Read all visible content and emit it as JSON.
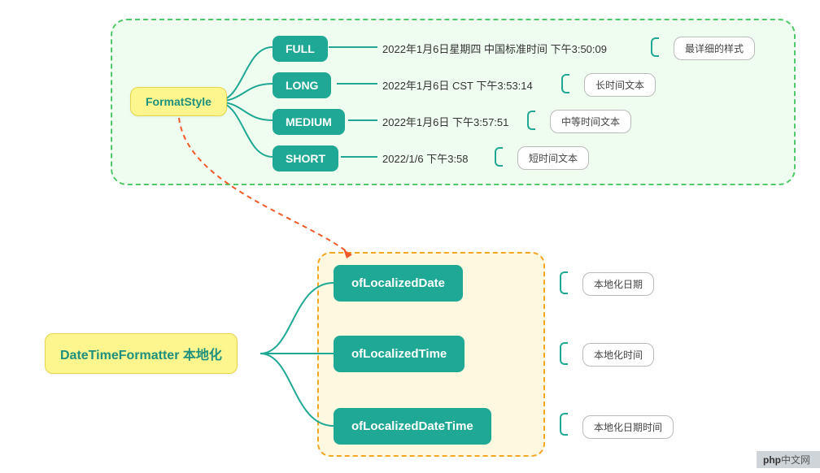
{
  "top": {
    "root": "FormatStyle",
    "items": [
      {
        "label": "FULL",
        "example": "2022年1月6日星期四 中国标准时间 下午3:50:09",
        "note": "最详细的样式"
      },
      {
        "label": "LONG",
        "example": "2022年1月6日 CST 下午3:53:14",
        "note": "长时间文本"
      },
      {
        "label": "MEDIUM",
        "example": "2022年1月6日 下午3:57:51",
        "note": "中等时间文本"
      },
      {
        "label": "SHORT",
        "example": "2022/1/6 下午3:58",
        "note": "短时间文本"
      }
    ]
  },
  "bottom": {
    "root": "DateTimeFormatter 本地化",
    "items": [
      {
        "label": "ofLocalizedDate",
        "note": "本地化日期"
      },
      {
        "label": "ofLocalizedTime",
        "note": "本地化时间"
      },
      {
        "label": "ofLocalizedDateTime",
        "note": "本地化日期时间"
      }
    ]
  },
  "watermark": {
    "strong": "php",
    "rest": "中文网"
  },
  "colors": {
    "teal": "#1fa994",
    "yellow": "#fdf68e",
    "green": "#4fc96a",
    "orange": "#f5a623"
  },
  "chart_data": {
    "type": "table",
    "title": "Java DateTimeFormatter localization mind-map",
    "sections": [
      {
        "name": "FormatStyle",
        "rows": [
          {
            "style": "FULL",
            "example": "2022年1月6日星期四 中国标准时间 下午3:50:09",
            "description": "最详细的样式"
          },
          {
            "style": "LONG",
            "example": "2022年1月6日 CST 下午3:53:14",
            "description": "长时间文本"
          },
          {
            "style": "MEDIUM",
            "example": "2022年1月6日 下午3:57:51",
            "description": "中等时间文本"
          },
          {
            "style": "SHORT",
            "example": "2022/1/6 下午3:58",
            "description": "短时间文本"
          }
        ]
      },
      {
        "name": "DateTimeFormatter 本地化",
        "rows": [
          {
            "method": "ofLocalizedDate",
            "description": "本地化日期"
          },
          {
            "method": "ofLocalizedTime",
            "description": "本地化时间"
          },
          {
            "method": "ofLocalizedDateTime",
            "description": "本地化日期时间"
          }
        ]
      }
    ]
  }
}
